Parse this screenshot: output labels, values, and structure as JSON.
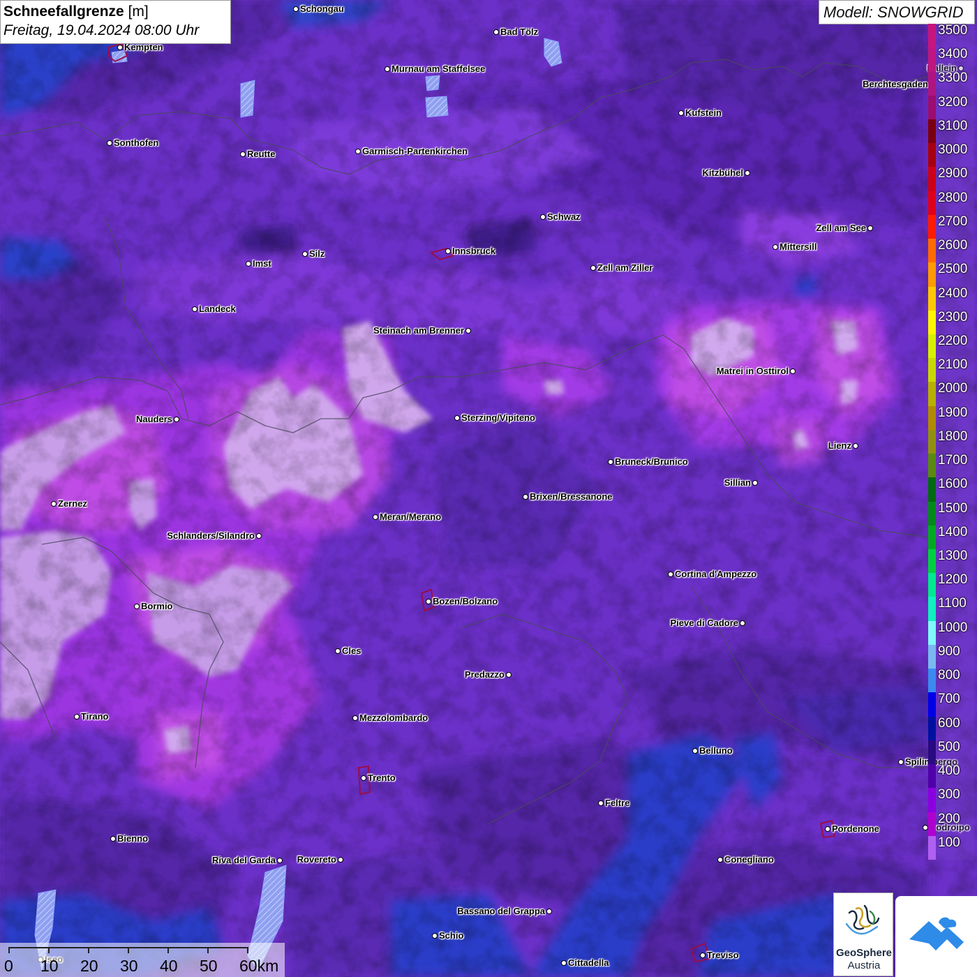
{
  "title": {
    "label": "Schneefallgrenze",
    "unit": "[m]",
    "datetime": "Freitag, 19.04.2024 08:00 Uhr"
  },
  "model": "Modell: SNOWGRID",
  "legend": [
    {
      "value": "3500",
      "color": "#c8157e"
    },
    {
      "value": "3400",
      "color": "#c01683"
    },
    {
      "value": "3300",
      "color": "#b01480"
    },
    {
      "value": "3200",
      "color": "#9b0d6f"
    },
    {
      "value": "3100",
      "color": "#7a0010"
    },
    {
      "value": "3000",
      "color": "#a80010"
    },
    {
      "value": "2900",
      "color": "#cc0018"
    },
    {
      "value": "2800",
      "color": "#e0001a"
    },
    {
      "value": "2700",
      "color": "#ff1a00"
    },
    {
      "value": "2600",
      "color": "#ff6a00"
    },
    {
      "value": "2500",
      "color": "#ff9a00"
    },
    {
      "value": "2400",
      "color": "#ffc800"
    },
    {
      "value": "2300",
      "color": "#fff500"
    },
    {
      "value": "2200",
      "color": "#d6f000"
    },
    {
      "value": "2100",
      "color": "#c8d800"
    },
    {
      "value": "2000",
      "color": "#b8b000"
    },
    {
      "value": "1900",
      "color": "#b08a00"
    },
    {
      "value": "1800",
      "color": "#909010"
    },
    {
      "value": "1700",
      "color": "#5a8a10"
    },
    {
      "value": "1600",
      "color": "#006a10"
    },
    {
      "value": "1500",
      "color": "#008a18"
    },
    {
      "value": "1400",
      "color": "#00aa20"
    },
    {
      "value": "1300",
      "color": "#00d040"
    },
    {
      "value": "1200",
      "color": "#00e890"
    },
    {
      "value": "1100",
      "color": "#10f0c0"
    },
    {
      "value": "1000",
      "color": "#80f8f8"
    },
    {
      "value": "900",
      "color": "#7ab8f0"
    },
    {
      "value": "800",
      "color": "#3a8af0"
    },
    {
      "value": "700",
      "color": "#0000e8"
    },
    {
      "value": "600",
      "color": "#0010a0"
    },
    {
      "value": "500",
      "color": "#2a0a80"
    },
    {
      "value": "400",
      "color": "#5000a8"
    },
    {
      "value": "300",
      "color": "#8a00e0"
    },
    {
      "value": "200",
      "color": "#b000d0"
    },
    {
      "value": "100",
      "color": "#b060f0"
    }
  ],
  "cities": [
    {
      "name": "Schongau",
      "side": "right"
    },
    {
      "name": "Bad Tölz",
      "side": "right"
    },
    {
      "name": "Kempten",
      "side": "right"
    },
    {
      "name": "Murnau am Staffelsee",
      "side": "right"
    },
    {
      "name": "Hallein",
      "side": "left"
    },
    {
      "name": "Berchtesgaden",
      "side": "left"
    },
    {
      "name": "Kufstein",
      "side": "right"
    },
    {
      "name": "Sonthofen",
      "side": "right"
    },
    {
      "name": "Reutte",
      "side": "right"
    },
    {
      "name": "Garmisch-Partenkirchen",
      "side": "right"
    },
    {
      "name": "Kitzbühel",
      "side": "left"
    },
    {
      "name": "Schwaz",
      "side": "right"
    },
    {
      "name": "Zell am See",
      "side": "left"
    },
    {
      "name": "Mittersill",
      "side": "right"
    },
    {
      "name": "Innsbruck",
      "side": "right"
    },
    {
      "name": "Silz",
      "side": "right"
    },
    {
      "name": "Imst",
      "side": "right"
    },
    {
      "name": "Zell am Ziller",
      "side": "right"
    },
    {
      "name": "Landeck",
      "side": "right"
    },
    {
      "name": "Steinach am Brenner",
      "side": "left"
    },
    {
      "name": "Matrei in Osttirol",
      "side": "left"
    },
    {
      "name": "Nauders",
      "side": "left"
    },
    {
      "name": "Sterzing/Vipiteno",
      "side": "right"
    },
    {
      "name": "Lienz",
      "side": "left"
    },
    {
      "name": "Bruneck/Brunico",
      "side": "right"
    },
    {
      "name": "Sillian",
      "side": "left"
    },
    {
      "name": "Zernez",
      "side": "right"
    },
    {
      "name": "Brixen/Bressanone",
      "side": "right"
    },
    {
      "name": "Meran/Merano",
      "side": "right"
    },
    {
      "name": "Schlanders/Silandro",
      "side": "left"
    },
    {
      "name": "Cortina d'Ampezzo",
      "side": "right"
    },
    {
      "name": "Bozen/Bolzano",
      "side": "right"
    },
    {
      "name": "Bormio",
      "side": "right"
    },
    {
      "name": "Pieve di Cadore",
      "side": "left"
    },
    {
      "name": "Cles",
      "side": "right"
    },
    {
      "name": "Predazzo",
      "side": "left"
    },
    {
      "name": "Tirano",
      "side": "right"
    },
    {
      "name": "Mezzolombardo",
      "side": "right"
    },
    {
      "name": "Belluno",
      "side": "right"
    },
    {
      "name": "Spilimbergo",
      "side": "right"
    },
    {
      "name": "Trento",
      "side": "right"
    },
    {
      "name": "Feltre",
      "side": "right"
    },
    {
      "name": "Pordenone",
      "side": "right"
    },
    {
      "name": "Codroipo",
      "side": "right"
    },
    {
      "name": "Bienno",
      "side": "right"
    },
    {
      "name": "Riva del Garda",
      "side": "left"
    },
    {
      "name": "Rovereto",
      "side": "left"
    },
    {
      "name": "Conegliano",
      "side": "right"
    },
    {
      "name": "Bassano del Grappa",
      "side": "left"
    },
    {
      "name": "Schio",
      "side": "right"
    },
    {
      "name": "Treviso",
      "side": "right"
    },
    {
      "name": "Cittadella",
      "side": "right"
    },
    {
      "name": "Iseo",
      "side": "right"
    }
  ],
  "scale_bar": {
    "labels": [
      "0",
      "10",
      "20",
      "30",
      "40",
      "50",
      "60km"
    ]
  },
  "logos": {
    "geosphere_name": "GeoSphere",
    "geosphere_sub": "Austria",
    "app_icon": "cloud-mountain-icon"
  }
}
